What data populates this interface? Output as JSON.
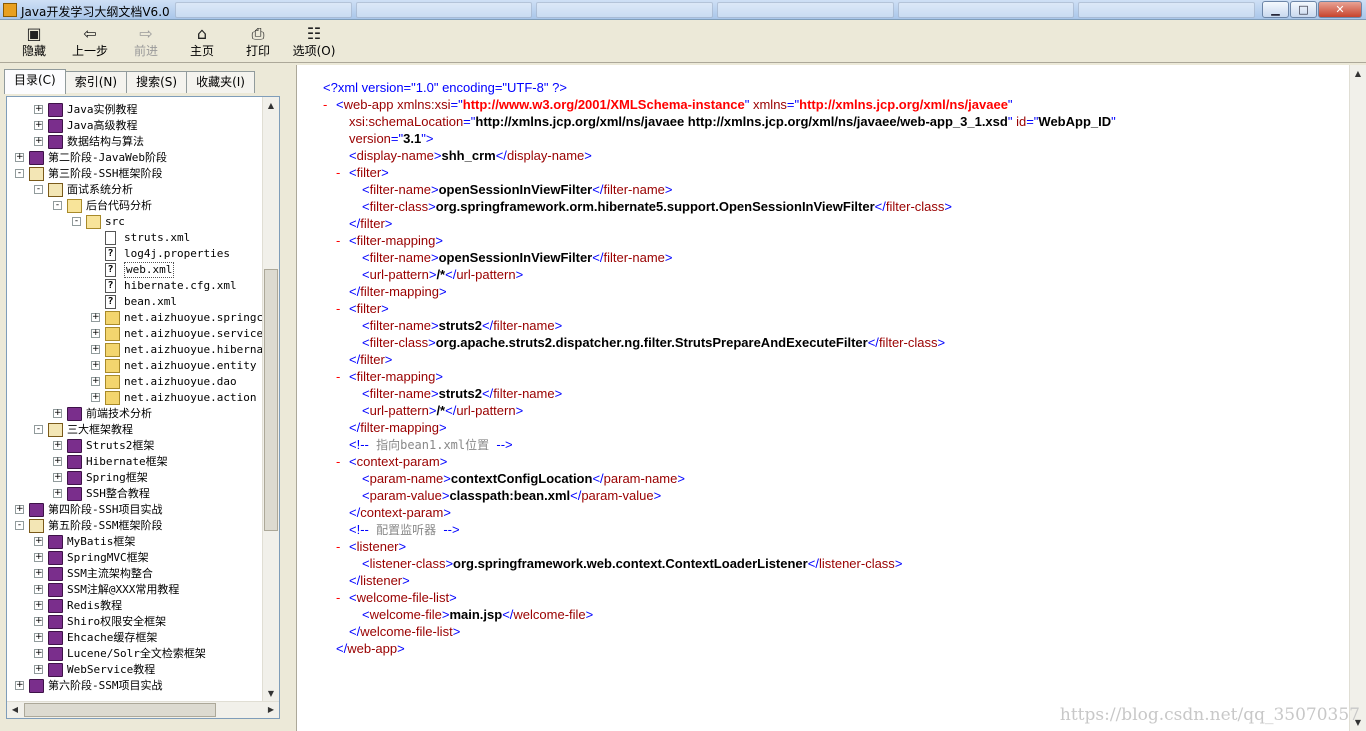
{
  "window": {
    "title": "Java开发学习大纲文档V6.0",
    "buttons": {
      "minimize": "▁",
      "maximize": "□",
      "close": "✕"
    }
  },
  "toolbar": [
    {
      "id": "hide",
      "label": "隐藏",
      "icon": "hide-icon",
      "glyph": "▣",
      "enabled": true
    },
    {
      "id": "back",
      "label": "上一步",
      "icon": "back-arrow-icon",
      "glyph": "⇦",
      "enabled": true
    },
    {
      "id": "forward",
      "label": "前进",
      "icon": "forward-arrow-icon",
      "glyph": "⇨",
      "enabled": false
    },
    {
      "id": "home",
      "label": "主页",
      "icon": "home-icon",
      "glyph": "⌂",
      "enabled": true
    },
    {
      "id": "print",
      "label": "打印",
      "icon": "print-icon",
      "glyph": "⎙",
      "enabled": true
    },
    {
      "id": "options",
      "label": "选项(O)",
      "icon": "options-icon",
      "glyph": "☷",
      "enabled": true
    }
  ],
  "nav_tabs": [
    {
      "label": "目录(C)",
      "active": true
    },
    {
      "label": "索引(N)",
      "active": false
    },
    {
      "label": "搜索(S)",
      "active": false
    },
    {
      "label": "收藏夹(I)",
      "active": false
    }
  ],
  "tree": [
    {
      "level": 1,
      "exp": "+",
      "icon": "book",
      "label": "Java实例教程"
    },
    {
      "level": 1,
      "exp": "+",
      "icon": "book",
      "label": "Java高级教程"
    },
    {
      "level": 1,
      "exp": "+",
      "icon": "book",
      "label": "数据结构与算法"
    },
    {
      "level": 0,
      "exp": "+",
      "icon": "book",
      "label": "第二阶段-JavaWeb阶段"
    },
    {
      "level": 0,
      "exp": "-",
      "icon": "bookopen",
      "label": "第三阶段-SSH框架阶段"
    },
    {
      "level": 1,
      "exp": "-",
      "icon": "bookopen",
      "label": "面试系统分析"
    },
    {
      "level": 2,
      "exp": "-",
      "icon": "folderopen",
      "label": "后台代码分析"
    },
    {
      "level": 3,
      "exp": "-",
      "icon": "folderopen",
      "label": "src"
    },
    {
      "level": 4,
      "exp": "",
      "icon": "page",
      "label": "struts.xml"
    },
    {
      "level": 4,
      "exp": "",
      "icon": "qpage",
      "label": "log4j.properties"
    },
    {
      "level": 4,
      "exp": "",
      "icon": "qpage",
      "label": "web.xml",
      "selected": true
    },
    {
      "level": 4,
      "exp": "",
      "icon": "qpage",
      "label": "hibernate.cfg.xml"
    },
    {
      "level": 4,
      "exp": "",
      "icon": "qpage",
      "label": "bean.xml"
    },
    {
      "level": 4,
      "exp": "+",
      "icon": "folder",
      "label": "net.aizhuoyue.springcon"
    },
    {
      "level": 4,
      "exp": "+",
      "icon": "folder",
      "label": "net.aizhuoyue.service"
    },
    {
      "level": 4,
      "exp": "+",
      "icon": "folder",
      "label": "net.aizhuoyue.hibernat"
    },
    {
      "level": 4,
      "exp": "+",
      "icon": "folder",
      "label": "net.aizhuoyue.entity"
    },
    {
      "level": 4,
      "exp": "+",
      "icon": "folder",
      "label": "net.aizhuoyue.dao"
    },
    {
      "level": 4,
      "exp": "+",
      "icon": "folder",
      "label": "net.aizhuoyue.action"
    },
    {
      "level": 2,
      "exp": "+",
      "icon": "book",
      "label": "前端技术分析"
    },
    {
      "level": 1,
      "exp": "-",
      "icon": "bookopen",
      "label": "三大框架教程"
    },
    {
      "level": 2,
      "exp": "+",
      "icon": "book",
      "label": "Struts2框架"
    },
    {
      "level": 2,
      "exp": "+",
      "icon": "book",
      "label": "Hibernate框架"
    },
    {
      "level": 2,
      "exp": "+",
      "icon": "book",
      "label": "Spring框架"
    },
    {
      "level": 2,
      "exp": "+",
      "icon": "book",
      "label": "SSH整合教程"
    },
    {
      "level": 0,
      "exp": "+",
      "icon": "book",
      "label": "第四阶段-SSH项目实战"
    },
    {
      "level": 0,
      "exp": "-",
      "icon": "bookopen",
      "label": "第五阶段-SSM框架阶段"
    },
    {
      "level": 1,
      "exp": "+",
      "icon": "book",
      "label": "MyBatis框架"
    },
    {
      "level": 1,
      "exp": "+",
      "icon": "book",
      "label": "SpringMVC框架"
    },
    {
      "level": 1,
      "exp": "+",
      "icon": "book",
      "label": "SSM主流架构整合"
    },
    {
      "level": 1,
      "exp": "+",
      "icon": "book",
      "label": "SSM注解@XXX常用教程"
    },
    {
      "level": 1,
      "exp": "+",
      "icon": "book",
      "label": "Redis教程"
    },
    {
      "level": 1,
      "exp": "+",
      "icon": "book",
      "label": "Shiro权限安全框架"
    },
    {
      "level": 1,
      "exp": "+",
      "icon": "book",
      "label": "Ehcache缓存框架"
    },
    {
      "level": 1,
      "exp": "+",
      "icon": "book",
      "label": "Lucene/Solr全文检索框架"
    },
    {
      "level": 1,
      "exp": "+",
      "icon": "book",
      "label": "WebService教程"
    },
    {
      "level": 0,
      "exp": "+",
      "icon": "book",
      "label": "第六阶段-SSM项目实战"
    }
  ],
  "xml_lines": [
    {
      "indent": 0,
      "minus": false,
      "segs": [
        [
          "pi",
          "<?xml version=\"1.0\" encoding=\"UTF-8\" ?>"
        ]
      ]
    },
    {
      "indent": 1,
      "minus": true,
      "segs": [
        [
          "m",
          "<"
        ],
        [
          "t",
          "web-app"
        ],
        [
          "an",
          " xmlns:xsi"
        ],
        [
          "m",
          "=\""
        ],
        [
          "av",
          "http://www.w3.org/2001/XMLSchema-instance"
        ],
        [
          "m",
          "\""
        ],
        [
          "an",
          " xmlns"
        ],
        [
          "m",
          "=\""
        ],
        [
          "av",
          "http://xmlns.jcp.org/xml/ns/javaee"
        ],
        [
          "m",
          "\""
        ]
      ]
    },
    {
      "indent": 2,
      "minus": false,
      "segs": [
        [
          "an",
          "xsi:schemaLocation"
        ],
        [
          "m",
          "=\""
        ],
        [
          "tx",
          "http://xmlns.jcp.org/xml/ns/javaee http://xmlns.jcp.org/xml/ns/javaee/web-app_3_1.xsd"
        ],
        [
          "m",
          "\""
        ],
        [
          "an",
          " id"
        ],
        [
          "m",
          "=\""
        ],
        [
          "tx",
          "WebApp_ID"
        ],
        [
          "m",
          "\""
        ]
      ]
    },
    {
      "indent": 2,
      "minus": false,
      "segs": [
        [
          "an",
          "version"
        ],
        [
          "m",
          "=\""
        ],
        [
          "tx",
          "3.1"
        ],
        [
          "m",
          "\">"
        ]
      ]
    },
    {
      "indent": 2,
      "minus": false,
      "segs": [
        [
          "m",
          "<"
        ],
        [
          "t",
          "display-name"
        ],
        [
          "m",
          ">"
        ],
        [
          "tx",
          "shh_crm"
        ],
        [
          "m",
          "</"
        ],
        [
          "t",
          "display-name"
        ],
        [
          "m",
          ">"
        ]
      ]
    },
    {
      "indent": 2,
      "minus": true,
      "segs": [
        [
          "m",
          "<"
        ],
        [
          "t",
          "filter"
        ],
        [
          "m",
          ">"
        ]
      ]
    },
    {
      "indent": 3,
      "minus": false,
      "segs": [
        [
          "m",
          "<"
        ],
        [
          "t",
          "filter-name"
        ],
        [
          "m",
          ">"
        ],
        [
          "tx",
          "openSessionInViewFilter"
        ],
        [
          "m",
          "</"
        ],
        [
          "t",
          "filter-name"
        ],
        [
          "m",
          ">"
        ]
      ]
    },
    {
      "indent": 3,
      "minus": false,
      "segs": [
        [
          "m",
          "<"
        ],
        [
          "t",
          "filter-class"
        ],
        [
          "m",
          ">"
        ],
        [
          "tx",
          "org.springframework.orm.hibernate5.support.OpenSessionInViewFilter"
        ],
        [
          "m",
          "</"
        ],
        [
          "t",
          "filter-class"
        ],
        [
          "m",
          ">"
        ]
      ]
    },
    {
      "indent": 2,
      "minus": false,
      "segs": [
        [
          "m",
          "</"
        ],
        [
          "t",
          "filter"
        ],
        [
          "m",
          ">"
        ]
      ]
    },
    {
      "indent": 2,
      "minus": true,
      "segs": [
        [
          "m",
          "<"
        ],
        [
          "t",
          "filter-mapping"
        ],
        [
          "m",
          ">"
        ]
      ]
    },
    {
      "indent": 3,
      "minus": false,
      "segs": [
        [
          "m",
          "<"
        ],
        [
          "t",
          "filter-name"
        ],
        [
          "m",
          ">"
        ],
        [
          "tx",
          "openSessionInViewFilter"
        ],
        [
          "m",
          "</"
        ],
        [
          "t",
          "filter-name"
        ],
        [
          "m",
          ">"
        ]
      ]
    },
    {
      "indent": 3,
      "minus": false,
      "segs": [
        [
          "m",
          "<"
        ],
        [
          "t",
          "url-pattern"
        ],
        [
          "m",
          ">"
        ],
        [
          "tx",
          "/*"
        ],
        [
          "m",
          "</"
        ],
        [
          "t",
          "url-pattern"
        ],
        [
          "m",
          ">"
        ]
      ]
    },
    {
      "indent": 2,
      "minus": false,
      "segs": [
        [
          "m",
          "</"
        ],
        [
          "t",
          "filter-mapping"
        ],
        [
          "m",
          ">"
        ]
      ]
    },
    {
      "indent": 2,
      "minus": true,
      "segs": [
        [
          "m",
          "<"
        ],
        [
          "t",
          "filter"
        ],
        [
          "m",
          ">"
        ]
      ]
    },
    {
      "indent": 3,
      "minus": false,
      "segs": [
        [
          "m",
          "<"
        ],
        [
          "t",
          "filter-name"
        ],
        [
          "m",
          ">"
        ],
        [
          "tx",
          "struts2"
        ],
        [
          "m",
          "</"
        ],
        [
          "t",
          "filter-name"
        ],
        [
          "m",
          ">"
        ]
      ]
    },
    {
      "indent": 3,
      "minus": false,
      "segs": [
        [
          "m",
          "<"
        ],
        [
          "t",
          "filter-class"
        ],
        [
          "m",
          ">"
        ],
        [
          "tx",
          "org.apache.struts2.dispatcher.ng.filter.StrutsPrepareAndExecuteFilter"
        ],
        [
          "m",
          "</"
        ],
        [
          "t",
          "filter-class"
        ],
        [
          "m",
          ">"
        ]
      ]
    },
    {
      "indent": 2,
      "minus": false,
      "segs": [
        [
          "m",
          "</"
        ],
        [
          "t",
          "filter"
        ],
        [
          "m",
          ">"
        ]
      ]
    },
    {
      "indent": 2,
      "minus": true,
      "segs": [
        [
          "m",
          "<"
        ],
        [
          "t",
          "filter-mapping"
        ],
        [
          "m",
          ">"
        ]
      ]
    },
    {
      "indent": 3,
      "minus": false,
      "segs": [
        [
          "m",
          "<"
        ],
        [
          "t",
          "filter-name"
        ],
        [
          "m",
          ">"
        ],
        [
          "tx",
          "struts2"
        ],
        [
          "m",
          "</"
        ],
        [
          "t",
          "filter-name"
        ],
        [
          "m",
          ">"
        ]
      ]
    },
    {
      "indent": 3,
      "minus": false,
      "segs": [
        [
          "m",
          "<"
        ],
        [
          "t",
          "url-pattern"
        ],
        [
          "m",
          ">"
        ],
        [
          "tx",
          "/*"
        ],
        [
          "m",
          "</"
        ],
        [
          "t",
          "url-pattern"
        ],
        [
          "m",
          ">"
        ]
      ]
    },
    {
      "indent": 2,
      "minus": false,
      "segs": [
        [
          "m",
          "</"
        ],
        [
          "t",
          "filter-mapping"
        ],
        [
          "m",
          ">"
        ]
      ]
    },
    {
      "indent": 2,
      "minus": false,
      "segs": [
        [
          "m",
          "<!--"
        ],
        [
          "cm",
          " 指向bean1.xml位置    "
        ],
        [
          "m",
          "-->"
        ]
      ]
    },
    {
      "indent": 2,
      "minus": true,
      "segs": [
        [
          "m",
          "<"
        ],
        [
          "t",
          "context-param"
        ],
        [
          "m",
          ">"
        ]
      ]
    },
    {
      "indent": 3,
      "minus": false,
      "segs": [
        [
          "m",
          "<"
        ],
        [
          "t",
          "param-name"
        ],
        [
          "m",
          ">"
        ],
        [
          "tx",
          "contextConfigLocation"
        ],
        [
          "m",
          "</"
        ],
        [
          "t",
          "param-name"
        ],
        [
          "m",
          ">"
        ]
      ]
    },
    {
      "indent": 3,
      "minus": false,
      "segs": [
        [
          "m",
          "<"
        ],
        [
          "t",
          "param-value"
        ],
        [
          "m",
          ">"
        ],
        [
          "tx",
          "classpath:bean.xml"
        ],
        [
          "m",
          "</"
        ],
        [
          "t",
          "param-value"
        ],
        [
          "m",
          ">"
        ]
      ]
    },
    {
      "indent": 2,
      "minus": false,
      "segs": [
        [
          "m",
          "</"
        ],
        [
          "t",
          "context-param"
        ],
        [
          "m",
          ">"
        ]
      ]
    },
    {
      "indent": 2,
      "minus": false,
      "segs": [
        [
          "m",
          "<!--"
        ],
        [
          "cm",
          " 配置监听器     "
        ],
        [
          "m",
          "-->"
        ]
      ]
    },
    {
      "indent": 2,
      "minus": true,
      "segs": [
        [
          "m",
          "<"
        ],
        [
          "t",
          "listener"
        ],
        [
          "m",
          ">"
        ]
      ]
    },
    {
      "indent": 3,
      "minus": false,
      "segs": [
        [
          "m",
          "<"
        ],
        [
          "t",
          "listener-class"
        ],
        [
          "m",
          ">"
        ],
        [
          "tx",
          "org.springframework.web.context.ContextLoaderListener"
        ],
        [
          "m",
          "</"
        ],
        [
          "t",
          "listener-class"
        ],
        [
          "m",
          ">"
        ]
      ]
    },
    {
      "indent": 2,
      "minus": false,
      "segs": [
        [
          "m",
          "</"
        ],
        [
          "t",
          "listener"
        ],
        [
          "m",
          ">"
        ]
      ]
    },
    {
      "indent": 2,
      "minus": true,
      "segs": [
        [
          "m",
          "<"
        ],
        [
          "t",
          "welcome-file-list"
        ],
        [
          "m",
          ">"
        ]
      ]
    },
    {
      "indent": 3,
      "minus": false,
      "segs": [
        [
          "m",
          "<"
        ],
        [
          "t",
          "welcome-file"
        ],
        [
          "m",
          ">"
        ],
        [
          "tx",
          "main.jsp"
        ],
        [
          "m",
          "</"
        ],
        [
          "t",
          "welcome-file"
        ],
        [
          "m",
          ">"
        ]
      ]
    },
    {
      "indent": 2,
      "minus": false,
      "segs": [
        [
          "m",
          "</"
        ],
        [
          "t",
          "welcome-file-list"
        ],
        [
          "m",
          ">"
        ]
      ]
    },
    {
      "indent": 1,
      "minus": false,
      "segs": [
        [
          "m",
          "</"
        ],
        [
          "t",
          "web-app"
        ],
        [
          "m",
          ">"
        ]
      ]
    }
  ],
  "watermark": "https://blog.csdn.net/qq_35070357"
}
